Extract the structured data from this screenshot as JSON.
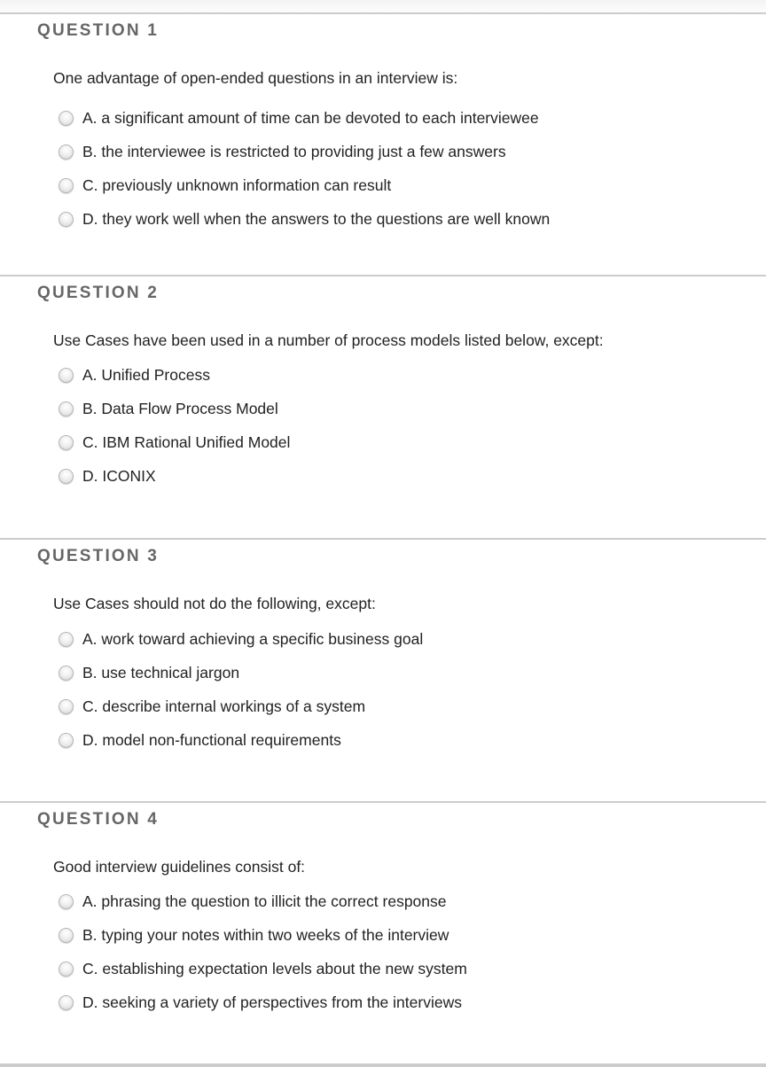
{
  "questions": [
    {
      "heading": "QUESTION 1",
      "text": "One advantage of open-ended questions in an interview is:",
      "options": [
        "A. a significant amount of time can be devoted to each interviewee",
        "B. the interviewee is restricted to providing just a few answers",
        "C. previously unknown information can result",
        "D. they work well when the answers to the questions are well known"
      ]
    },
    {
      "heading": "QUESTION 2",
      "text": "Use Cases have been used in a number of process models listed below, except:",
      "options": [
        "A. Unified Process",
        "B. Data Flow Process Model",
        "C. IBM Rational Unified Model",
        "D. ICONIX"
      ]
    },
    {
      "heading": "QUESTION 3",
      "text": "Use Cases should not do the following, except:",
      "options": [
        "A. work toward achieving a specific business goal",
        "B. use technical jargon",
        "C. describe internal workings of a system",
        "D. model non-functional requirements"
      ]
    },
    {
      "heading": "QUESTION 4",
      "text": "Good interview guidelines consist of:",
      "options": [
        "A. phrasing the question to illicit the correct response",
        "B. typing your notes within two weeks of the interview",
        "C. establishing expectation levels about the new system",
        "D. seeking a variety of perspectives from the interviews"
      ]
    }
  ]
}
